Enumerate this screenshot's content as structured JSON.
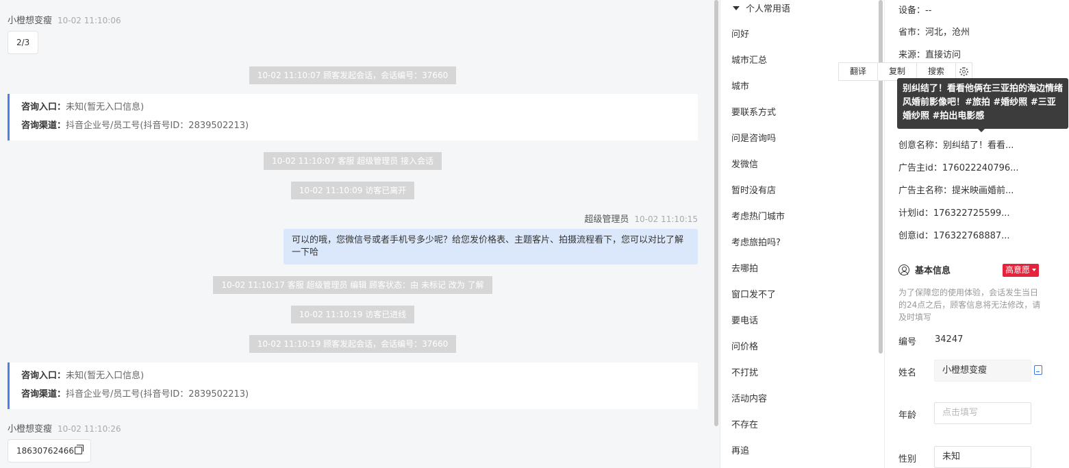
{
  "chat": {
    "messages": [
      {
        "sender": "小橙想变瘦",
        "time": "10-02 11:10:06",
        "text": "2/3"
      },
      {
        "system": "10-02 11:10:07 顾客发起会话，会话编号：37660"
      },
      {
        "card": {
          "entry_label": "咨询入口：",
          "entry_value": "未知(暂无入口信息)",
          "channel_label": "咨询渠道：",
          "channel_value": "抖音企业号/员工号(抖音号ID：2839502213)"
        }
      },
      {
        "system": "10-02 11:10:07 客服 超级管理员 接入会话"
      },
      {
        "system": "10-02 11:10:09 访客已离开"
      },
      {
        "agent": "超级管理员",
        "time": "10-02 11:10:15",
        "text": "可以的哦，您微信号或者手机号多少呢？给您发价格表、主题客片、拍摄流程看下，您可以对比了解一下哈"
      },
      {
        "system": "10-02 11:10:17 客服 超级管理员 编辑 顾客状态：由 未标记 改为 了解"
      },
      {
        "system": "10-02 11:10:19 访客已进线"
      },
      {
        "system": "10-02 11:10:19 顾客发起会话，会话编号：37660"
      },
      {
        "card": {
          "entry_label": "咨询入口：",
          "entry_value": "未知(暂无入口信息)",
          "channel_label": "咨询渠道：",
          "channel_value": "抖音企业号/员工号(抖音号ID：2839502213)"
        }
      },
      {
        "sender": "小橙想变瘦",
        "time": "10-02 11:10:26",
        "text": "18630762466"
      }
    ]
  },
  "phrases": {
    "header": "个人常用语",
    "items": [
      "问好",
      "城市汇总",
      "城市",
      "要联系方式",
      "问是咨询吗",
      "发微信",
      "暂时没有店",
      "考虑热门城市",
      "考虑旅拍吗?",
      "去哪拍",
      "窗口发不了",
      "要电话",
      "问价格",
      "不打扰",
      "活动内容",
      "不存在",
      "再追"
    ]
  },
  "customer": {
    "rows": [
      {
        "label": "设备：",
        "value": "--"
      },
      {
        "label": "省市：",
        "value": "河北，沧州"
      },
      {
        "label": "来源：",
        "value": "直接访问"
      },
      {
        "label": "创意名称：",
        "value": "别纠结了！看看..."
      },
      {
        "label": "广告主id：",
        "value": "176022240796..."
      },
      {
        "label": "广告主名称：",
        "value": "提米映画婚前..."
      },
      {
        "label": "计划id：",
        "value": "176322725599..."
      },
      {
        "label": "创意id：",
        "value": "176322768887..."
      }
    ],
    "basic_info_title": "基本信息",
    "intent_badge": "高意愿",
    "notice": "为了保障您的使用体验，会话发生当日的24点之后，顾客信息将无法修改，请及时填写",
    "fields": {
      "number_label": "编号",
      "number_value": "34247",
      "name_label": "姓名",
      "name_value": "小橙想变瘦",
      "age_label": "年龄",
      "age_placeholder": "点击填写",
      "gender_label": "性别",
      "gender_value": "未知"
    }
  },
  "context_menu": {
    "translate": "翻译",
    "copy": "复制",
    "search": "搜索"
  },
  "tooltip": {
    "text": "别纠结了！看看他俩在三亚拍的海边情绪风婚前影像吧！#旅拍 #婚纱照 #三亚婚纱照 #拍出电影感"
  }
}
